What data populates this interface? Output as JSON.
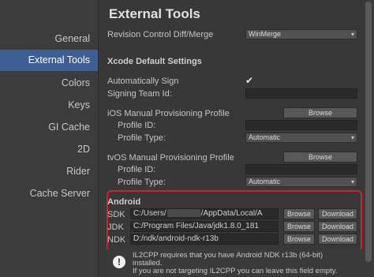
{
  "sidebar": {
    "items": [
      {
        "label": "General"
      },
      {
        "label": "External Tools"
      },
      {
        "label": "Colors"
      },
      {
        "label": "Keys"
      },
      {
        "label": "GI Cache"
      },
      {
        "label": "2D"
      },
      {
        "label": "Rider"
      },
      {
        "label": "Cache Server"
      }
    ],
    "selected": "External Tools"
  },
  "main": {
    "title": "External Tools",
    "revision_control": {
      "label": "Revision Control Diff/Merge",
      "value": "WinMerge"
    },
    "xcode_section": "Xcode Default Settings",
    "automatically_sign": {
      "label": "Automatically Sign",
      "checked": true
    },
    "signing_team": {
      "label": "Signing Team Id:",
      "value": ""
    },
    "ios_profile": {
      "label": "iOS Manual Provisioning Profile",
      "browse": "Browse",
      "id_label": "Profile ID:",
      "id_value": "",
      "type_label": "Profile Type:",
      "type_value": "Automatic"
    },
    "tvos_profile": {
      "label": "tvOS Manual Provisioning Profile",
      "browse": "Browse",
      "id_label": "Profile ID:",
      "id_value": "",
      "type_label": "Profile Type:",
      "type_value": "Automatic"
    },
    "android": {
      "section": "Android",
      "sdk": {
        "label": "SDK",
        "path_start": "C:/Users/",
        "path_end": "/AppData/Local/A",
        "browse": "Browse",
        "download": "Download"
      },
      "jdk": {
        "label": "JDK",
        "path": "C:/Program Files/Java/jdk1.8.0_181",
        "browse": "Browse",
        "download": "Download"
      },
      "ndk": {
        "label": "NDK",
        "path": "D:/ndk/android-ndk-r13b",
        "browse": "Browse",
        "download": "Download"
      }
    },
    "warning": {
      "line1": "IL2CPP requires that you have Android NDK r13b (64-bit)",
      "line2": "installed.",
      "line3": "If you are not targeting IL2CPP you can leave this field empty."
    }
  },
  "icons": {
    "warning": "exclamation-icon",
    "checkmark": "checkmark-icon"
  },
  "colors": {
    "selection": "#3e5f96",
    "highlight_box": "#d3202f"
  }
}
